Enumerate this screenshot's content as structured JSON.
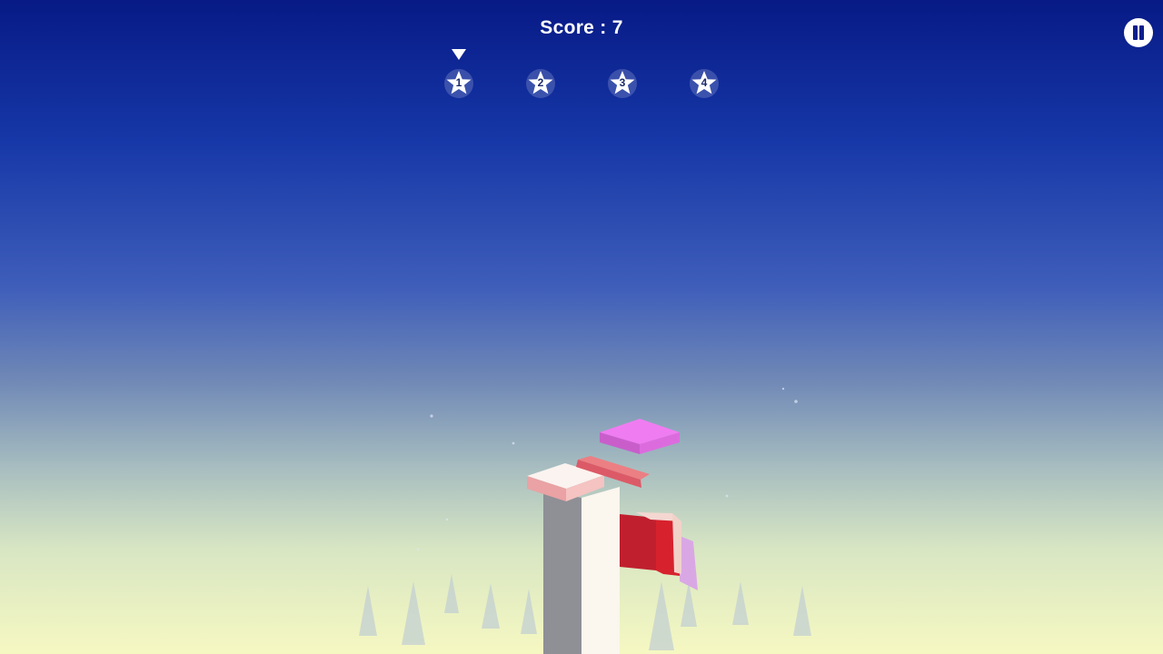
{
  "hud": {
    "score_label": "Score : 7",
    "pause_button": "pause-icon"
  },
  "levels": [
    {
      "label": "1",
      "current": true
    },
    {
      "label": "2",
      "current": false
    },
    {
      "label": "3",
      "current": false
    },
    {
      "label": "4",
      "current": false
    }
  ],
  "colors": {
    "sky_top": "#071a86",
    "sky_bottom": "#f6f8c2",
    "tower_light": "#fbf6ee",
    "tower_shadow": "#8f8f96",
    "moving_block": "#e776e6",
    "falling_block": "#c0202e",
    "tree": "#b8c7cf"
  }
}
